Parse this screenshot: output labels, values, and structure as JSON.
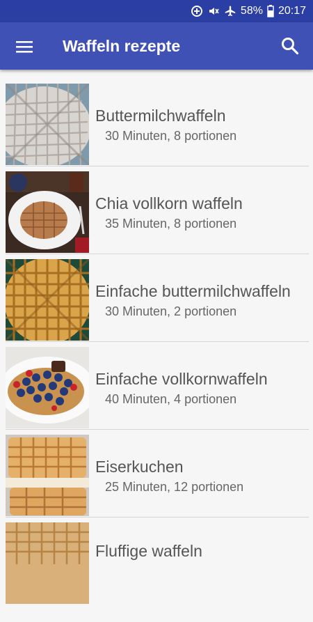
{
  "status": {
    "battery": "58%",
    "time": "20:17"
  },
  "appbar": {
    "title": "Waffeln rezepte"
  },
  "recipes": [
    {
      "name": "Buttermilchwaffeln",
      "meta": "30 Minuten, 8 portionen"
    },
    {
      "name": "Chia vollkorn waffeln",
      "meta": "35 Minuten, 8 portionen"
    },
    {
      "name": "Einfache buttermilchwaffeln",
      "meta": "30 Minuten, 2 portionen"
    },
    {
      "name": "Einfache vollkornwaffeln",
      "meta": "40 Minuten, 4 portionen"
    },
    {
      "name": "Eiserkuchen",
      "meta": "25 Minuten, 12 portionen"
    },
    {
      "name": "Fluffige waffeln",
      "meta": ""
    }
  ]
}
